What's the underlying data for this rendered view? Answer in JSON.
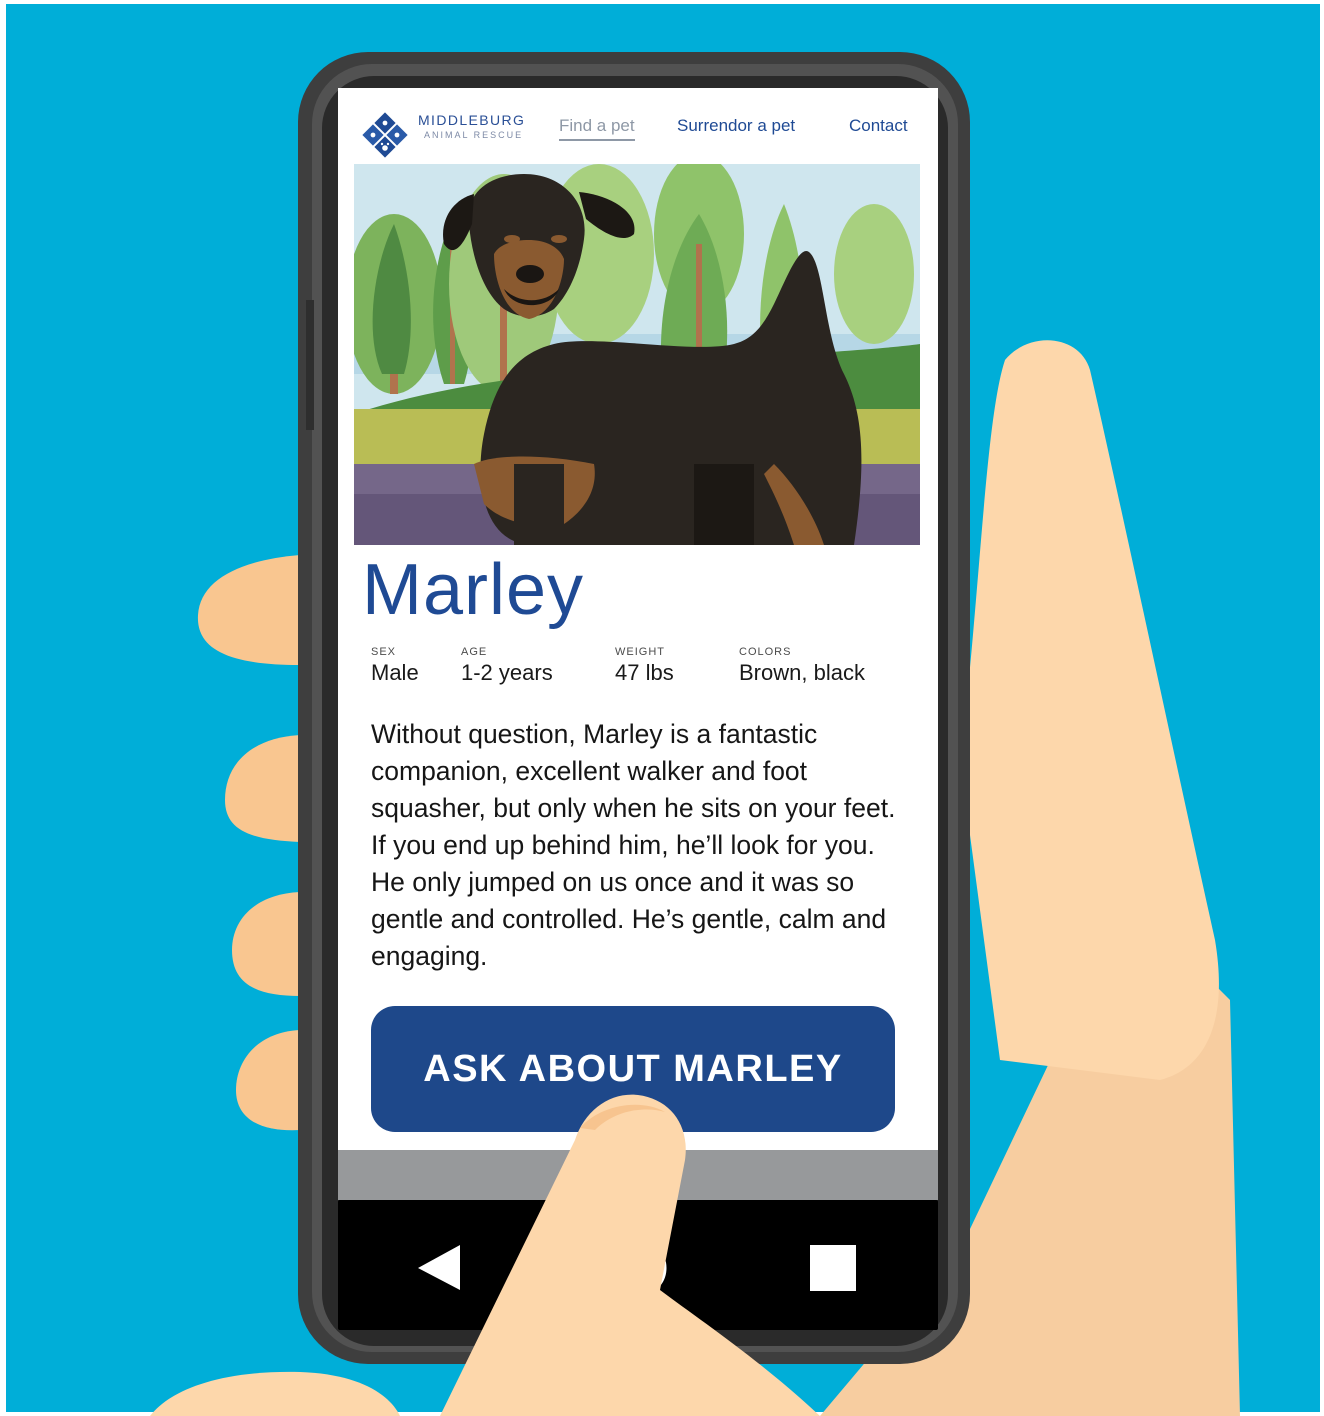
{
  "brand": {
    "name": "MIDDLEBURG",
    "subtitle": "ANIMAL RESCUE"
  },
  "nav": {
    "items": [
      {
        "label": "Find a pet",
        "active": true
      },
      {
        "label": "Surrendor a pet",
        "active": false
      },
      {
        "label": "Contact",
        "active": false
      }
    ]
  },
  "pet": {
    "name": "Marley",
    "attributes": [
      {
        "label": "SEX",
        "value": "Male"
      },
      {
        "label": "AGE",
        "value": "1-2 years"
      },
      {
        "label": "WEIGHT",
        "value": "47 lbs"
      },
      {
        "label": "COLORS",
        "value": "Brown, black"
      }
    ],
    "description": "Without question, Marley is a fantastic companion, excellent walker and foot squasher, but only when he sits on your feet. If you end up behind him, he’ll look for you. He only jumped on us once and it was so gentle and controlled. He’s gentle, calm and engaging."
  },
  "cta": {
    "label": "ASK ABOUT MARLEY"
  },
  "system_nav": {
    "icons": [
      "back-icon",
      "home-icon",
      "recents-icon"
    ]
  },
  "colors": {
    "background": "#00aed8",
    "brand_blue": "#1f4a94",
    "button": "#1e488a",
    "phone_body": "#3e3e3e",
    "skin": "#fdd7ab"
  }
}
